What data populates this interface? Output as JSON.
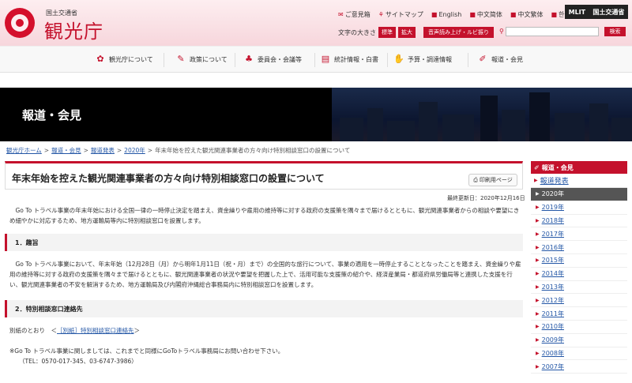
{
  "header": {
    "logo_sub": "国土交通省",
    "logo_main": "観光庁",
    "util_links": [
      "ご意見箱",
      "サイトマップ",
      "English",
      "中文简体",
      "中文繁体",
      "한국어"
    ],
    "mlit_logo": [
      "MLIT",
      "国土交通省"
    ],
    "text_size_label": "文字の大きさ",
    "text_size_options": [
      "標準",
      "拡大"
    ],
    "voice_button": "音声読み上げ・ルビ振り",
    "search_button": "検索",
    "search_placeholder": ""
  },
  "gnav": {
    "items": [
      {
        "label": "観光庁について",
        "icon": "flower-icon"
      },
      {
        "label": "政策について",
        "icon": "pen-icon"
      },
      {
        "label": "委員会・会議等",
        "icon": "meeting-icon"
      },
      {
        "label": "統計情報・白書",
        "icon": "chart-icon"
      },
      {
        "label": "予算・調達情報",
        "icon": "handshake-icon"
      },
      {
        "label": "報道・会見",
        "icon": "microphone-icon"
      }
    ]
  },
  "hero": {
    "title": "報道・会見"
  },
  "breadcrumb": {
    "links": [
      "観光庁ホーム",
      "報道・会見",
      "報道発表",
      "2020年"
    ],
    "current": "年末年始を控えた観光関連事業者の方々向け特別相談窓口の設置について",
    "separator": ">"
  },
  "article": {
    "title": "年末年始を控えた観光関連事業者の方々向け特別相談窓口の設置について",
    "print_label": "印刷用ページ",
    "updated": "最終更新日：2020年12月16日",
    "intro": "　Go To トラベル事業の年末年始における全国一律の一時停止決定を踏まえ、資金繰りや雇用の維持等に対する政府の支援策を隅々まで届けるとともに、観光関連事業者からの相談や要望にきめ細やかに対応するため、地方運輸局等内に特別相談窓口を設置します。",
    "section1_title": "1．趣旨",
    "section1_body": "　Go To トラベル事業において、年末年始（12月28日（月）から明年1月11日（祝・月）まで）の全国的な旅行について、事業の適用を一時停止することとなったことを踏まえ、資金繰りや雇用の維持等に対する政府の支援策を隅々まで届けるとともに、観光関連事業者の状況や要望を把握した上で、活用可能な支援策の紹介や、経済産業局・都道府県労働局等と連携した支援を行い、観光関連事業者の不安を解消するため、地方運輸局及び内閣府沖縄総合事務局内に特別相談窓口を設置します。",
    "section2_title": "2．特別相談窓口連絡先",
    "attachment_prefix": "別紙のとおり　＜",
    "attachment_link": "［別紙］特別相談窓口連絡先",
    "attachment_suffix": "＞",
    "note": "※Go To トラベル事業に関しましては、これまでと同様にGoToトラベル事務局にお問い合わせ下さい。",
    "phone": "（TEL：0570-017-345、03-6747-3986）"
  },
  "sidebar": {
    "head": "報道・会見",
    "sub": "報道発表",
    "years": [
      "2020年",
      "2019年",
      "2018年",
      "2017年",
      "2016年",
      "2015年",
      "2014年",
      "2013年",
      "2012年",
      "2011年",
      "2010年",
      "2009年",
      "2008年",
      "2007年"
    ],
    "active_year": "2020年"
  },
  "colors": {
    "accent": "#c4112c",
    "link": "#2457a6"
  }
}
